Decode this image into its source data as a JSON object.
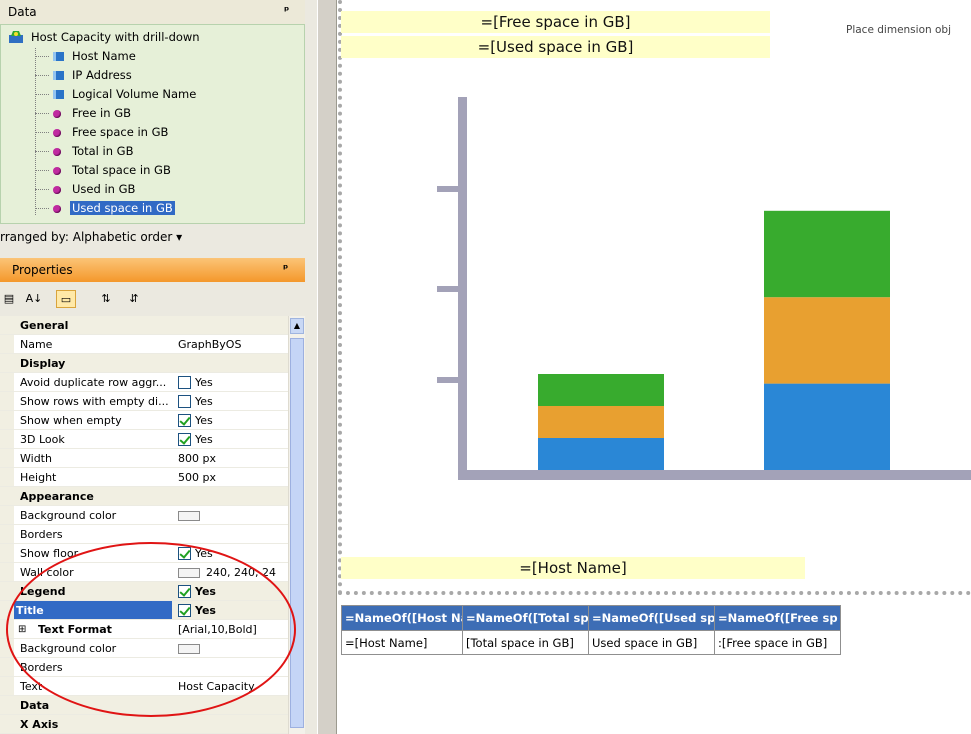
{
  "data_panel": {
    "title": "Data",
    "pin": "ᵖ",
    "root": "Host Capacity with drill-down",
    "items": [
      {
        "label": "Host Name",
        "kind": "dimension"
      },
      {
        "label": "IP Address",
        "kind": "dimension"
      },
      {
        "label": "Logical Volume Name",
        "kind": "dimension"
      },
      {
        "label": "Free in GB",
        "kind": "measure"
      },
      {
        "label": "Free space in GB",
        "kind": "measure"
      },
      {
        "label": "Total in GB",
        "kind": "measure"
      },
      {
        "label": "Total space in GB",
        "kind": "measure"
      },
      {
        "label": "Used in GB",
        "kind": "measure"
      },
      {
        "label": "Used space in GB",
        "kind": "measure",
        "selected": true
      }
    ],
    "arranged_by": "rranged by: Alphabetic order ▾"
  },
  "properties": {
    "title": "Properties",
    "pin": "ᵖ",
    "toolbar": {
      "b1": "▤",
      "b2": "A↓",
      "b3": "▭",
      "b4": "⇅",
      "b5": "⇵"
    },
    "rows": [
      {
        "type": "cat",
        "key": "General"
      },
      {
        "key": "Name",
        "value": "GraphByOS"
      },
      {
        "type": "cat",
        "key": "Display"
      },
      {
        "key": "Avoid duplicate row aggr...",
        "check": false,
        "value": "Yes"
      },
      {
        "key": "Show rows with empty di...",
        "check": false,
        "value": "Yes"
      },
      {
        "key": "Show when empty",
        "check": true,
        "value": "Yes"
      },
      {
        "key": "3D Look",
        "check": true,
        "value": "Yes"
      },
      {
        "key": "Width",
        "value": "800 px"
      },
      {
        "key": "Height",
        "value": "500 px"
      },
      {
        "type": "cat",
        "key": "Appearance"
      },
      {
        "key": "Background color",
        "swatch": true,
        "value": ""
      },
      {
        "key": "Borders",
        "value": ""
      },
      {
        "key": "Show floor",
        "check": true,
        "value": "Yes"
      },
      {
        "key": "Wall color",
        "swatch": true,
        "value": "240, 240, 24"
      },
      {
        "type": "cat",
        "key": "Legend",
        "check": true,
        "value": "Yes"
      },
      {
        "type": "cat",
        "key": "Title",
        "check": true,
        "value": "Yes",
        "selected": true
      },
      {
        "type": "sub",
        "key": "Text Format",
        "value": "[Arial,10,Bold]"
      },
      {
        "key": "Background color",
        "swatch": true,
        "value": ""
      },
      {
        "key": "Borders",
        "value": ""
      },
      {
        "key": "Text",
        "value": "Host Capacity"
      },
      {
        "type": "cat",
        "key": "Data"
      },
      {
        "type": "cat",
        "key": "X Axis"
      }
    ]
  },
  "canvas": {
    "label_free": "=[Free space in GB]",
    "label_used": "=[Used space in GB]",
    "label_host": "=[Host Name]",
    "place_hint": "Place dimension obj",
    "colors": {
      "blue": "#2a87d6",
      "orange": "#e8a030",
      "green": "#38ab2e",
      "axis": "#a3a2b8"
    }
  },
  "chart_data": {
    "type": "bar",
    "categories": [
      "",
      ""
    ],
    "series": [
      {
        "values": [
          1,
          2.7
        ]
      },
      {
        "values": [
          1,
          2.7
        ]
      },
      {
        "values": [
          1,
          2.7
        ]
      }
    ],
    "stacked": true
  },
  "table": {
    "headers": [
      "=NameOf([Host Na",
      "=NameOf([Total sp",
      "=NameOf([Used sp",
      "=NameOf([Free sp"
    ],
    "row": [
      "=[Host Name]",
      "[Total space in GB]",
      "Used space in GB]",
      ":[Free space in GB]"
    ]
  }
}
